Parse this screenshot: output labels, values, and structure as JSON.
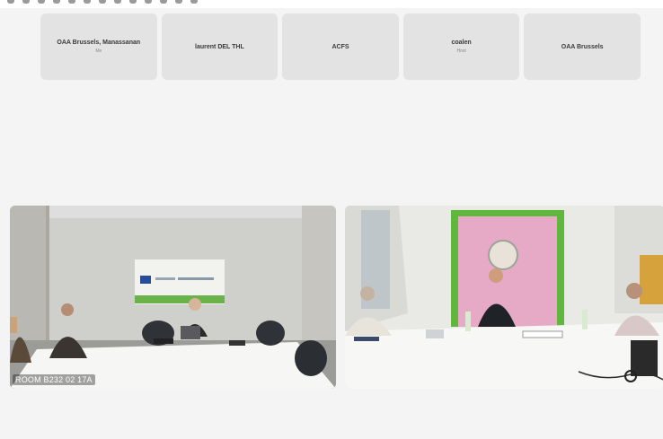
{
  "participants": [
    {
      "name": "OAA Brussels, Manassanan",
      "sub": "Me"
    },
    {
      "name": "laurent DEL THL",
      "sub": ""
    },
    {
      "name": "ACFS",
      "sub": ""
    },
    {
      "name": "coalen",
      "sub": "Host"
    },
    {
      "name": "OAA Brussels",
      "sub": ""
    }
  ],
  "videos": {
    "left": {
      "caption": "ROOM B232 02 17A"
    },
    "right": {
      "caption": ""
    }
  },
  "colors": {
    "page_bg": "#f4f4f4",
    "tile_bg": "#e3e3e3",
    "pink_wall": "#e6a9c6",
    "green_frame": "#5fb83b"
  }
}
